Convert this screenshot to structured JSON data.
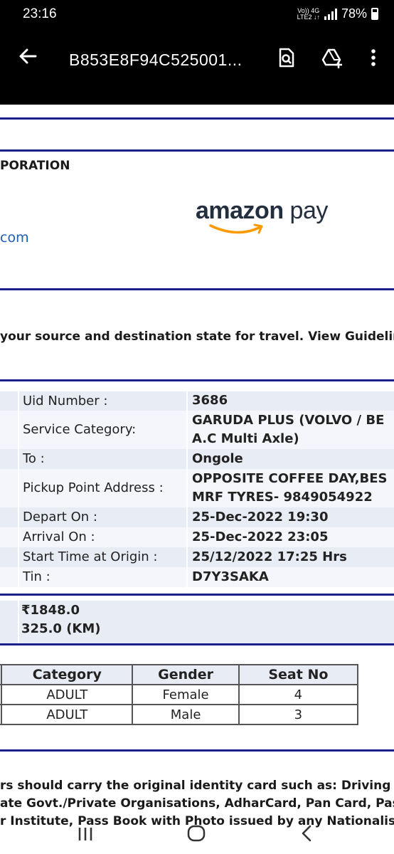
{
  "status_bar": {
    "time": "23:16",
    "network_line1": "Vo)) 4G",
    "network_line2": "LTE2 ↓↑",
    "battery": "78%"
  },
  "app_bar": {
    "title": "B853E8F94C525001...",
    "icons": [
      "back-arrow-icon",
      "document-search-icon",
      "drive-add-icon",
      "more-vert-icon"
    ]
  },
  "document": {
    "corp_fragment": "PORATION",
    "link_fragment": "com",
    "logo_text": "amazon",
    "logo_text2": "pay",
    "guidelines": "your source and destination state for travel. View Guidelines:",
    "info": [
      {
        "label": "Uid Number :",
        "value": "3686"
      },
      {
        "label": "Service Category:",
        "value": "GARUDA PLUS (VOLVO / BE",
        "value2": "A.C Multi Axle)"
      },
      {
        "label": "To :",
        "value": "Ongole"
      },
      {
        "label": "Pickup Point Address :",
        "value": "OPPOSITE COFFEE DAY,BES",
        "value2": "MRF TYRES- 9849054922"
      },
      {
        "label": "Depart On :",
        "value": "25-Dec-2022 19:30"
      },
      {
        "label": "Arrival On :",
        "value": "25-Dec-2022 23:05"
      },
      {
        "label": "Start Time at Origin :",
        "value": "25/12/2022 17:25 Hrs"
      },
      {
        "label": "Tin :",
        "value": "D7Y3SAKA"
      }
    ],
    "fare": "₹1848.0",
    "distance": "325.0 (KM)",
    "passengers": {
      "headers": [
        "Category",
        "Gender",
        "Seat No"
      ],
      "rows": [
        [
          "ADULT",
          "Female",
          "4"
        ],
        [
          "ADULT",
          "Male",
          "3"
        ]
      ]
    },
    "notes": [
      "rs should carry the original identity card such as: Driving Licen",
      "ate Govt./Private Organisations, AdharCard, Pan Card, Passpo",
      "r Institute, Pass Book with Photo issued by any Nationalised B"
    ]
  },
  "colors": {
    "rule": "#1a1f8c",
    "shade": "#e8ecf5",
    "link": "#1d5fb0",
    "amazon_orange": "#ff9900"
  }
}
